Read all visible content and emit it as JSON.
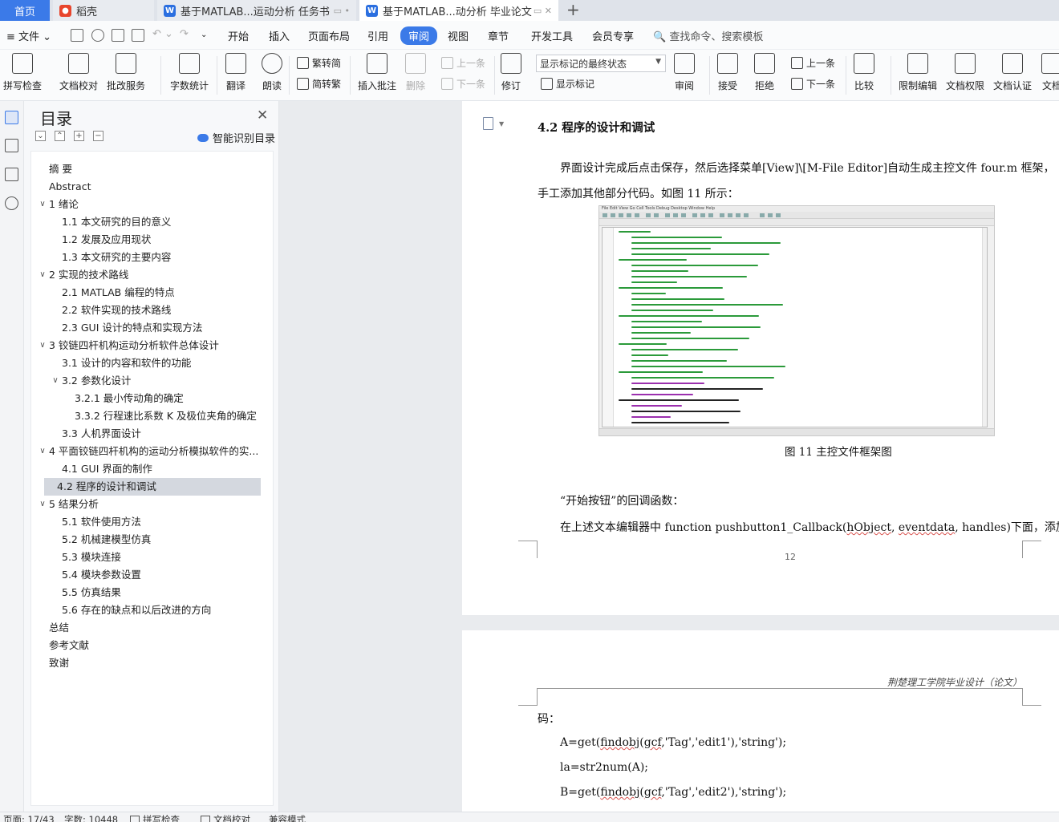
{
  "tabs": {
    "home": "首页",
    "daoke": "稻壳",
    "doc1": "基于MATLAB...运动分析 任务书",
    "doc2": "基于MATLAB...动分析 毕业论文",
    "add": "+"
  },
  "menu": {
    "file": "文件",
    "items": [
      "开始",
      "插入",
      "页面布局",
      "引用",
      "审阅",
      "视图",
      "章节",
      "开发工具",
      "会员专享"
    ],
    "active": "审阅",
    "search": "查找命令、搜索模板"
  },
  "ribbon": {
    "spellcheck": "拼写检查",
    "proofread": "文档校对",
    "annotate_service": "批改服务",
    "wordcount": "字数统计",
    "translate": "翻译",
    "read_aloud": "朗读",
    "trad": "繁转简",
    "simp": "简转繁",
    "insert_comment": "插入批注",
    "delete": "删除",
    "prev_comment": "上一条",
    "next_comment": "下一条",
    "revise": "修订",
    "markup_select": "显示标记的最终状态",
    "show_markup": "显示标记",
    "review": "审阅",
    "accept": "接受",
    "reject": "拒绝",
    "prev_change": "上一条",
    "next_change": "下一条",
    "compare": "比较",
    "restrict_edit": "限制编辑",
    "doc_rights": "文档权限",
    "doc_auth": "文档认证",
    "doc_more": "文档"
  },
  "toc": {
    "title": "目录",
    "smart": "智能识别目录",
    "items": [
      {
        "label": "摘  要",
        "level": 0,
        "arrow": ""
      },
      {
        "label": "Abstract",
        "level": 0,
        "arrow": ""
      },
      {
        "label": "1  绪论",
        "level": 0,
        "arrow": "∨"
      },
      {
        "label": "1.1  本文研究的目的意义",
        "level": 1,
        "arrow": ""
      },
      {
        "label": "1.2  发展及应用现状",
        "level": 1,
        "arrow": ""
      },
      {
        "label": "1.3  本文研究的主要内容",
        "level": 1,
        "arrow": ""
      },
      {
        "label": "2  实现的技术路线",
        "level": 0,
        "arrow": "∨"
      },
      {
        "label": "2.1 MATLAB 编程的特点",
        "level": 1,
        "arrow": ""
      },
      {
        "label": "2.2  软件实现的技术路线",
        "level": 1,
        "arrow": ""
      },
      {
        "label": "2.3 GUI 设计的特点和实现方法",
        "level": 1,
        "arrow": ""
      },
      {
        "label": "3  铰链四杆机构运动分析软件总体设计",
        "level": 0,
        "arrow": "∨"
      },
      {
        "label": "3.1  设计的内容和软件的功能",
        "level": 1,
        "arrow": ""
      },
      {
        "label": "3.2  参数化设计",
        "level": 1,
        "arrow": "∨"
      },
      {
        "label": "3.2.1  最小传动角的确定",
        "level": 2,
        "arrow": ""
      },
      {
        "label": "3.3.2  行程速比系数 K 及极位夹角的确定",
        "level": 2,
        "arrow": ""
      },
      {
        "label": "3.3  人机界面设计",
        "level": 1,
        "arrow": ""
      },
      {
        "label": "4  平面铰链四杆机构的运动分析模拟软件的实...",
        "level": 0,
        "arrow": "∨"
      },
      {
        "label": "4.1 GUI 界面的制作",
        "level": 1,
        "arrow": ""
      },
      {
        "label": "4.2  程序的设计和调试",
        "level": 1,
        "arrow": "",
        "selected": true
      },
      {
        "label": "5  结果分析",
        "level": 0,
        "arrow": "∨"
      },
      {
        "label": "5.1 软件使用方法",
        "level": 1,
        "arrow": ""
      },
      {
        "label": "5.2  机械建模型仿真",
        "level": 1,
        "arrow": ""
      },
      {
        "label": "5.3  模块连接",
        "level": 1,
        "arrow": ""
      },
      {
        "label": "5.4  模块参数设置",
        "level": 1,
        "arrow": ""
      },
      {
        "label": "5.5  仿真结果",
        "level": 1,
        "arrow": ""
      },
      {
        "label": "5.6  存在的缺点和以后改进的方向",
        "level": 1,
        "arrow": ""
      },
      {
        "label": "总结",
        "level": 0,
        "arrow": ""
      },
      {
        "label": "参考文献",
        "level": 0,
        "arrow": ""
      },
      {
        "label": "致谢",
        "level": 0,
        "arrow": ""
      }
    ]
  },
  "doc": {
    "heading": "4.2  程序的设计和调试",
    "para1_line1": "界面设计完成后点击保存，然后选择菜单[View]\\[M-File Editor]自动生成主控文件 four.m 框架，",
    "para1_line2": "手工添加其他部分代码。如图 11 所示：",
    "fig_menu": "File  Edit  View  Go  Cell  Tools  Debug  Desktop  Window  Help",
    "fig_caption": "图 11 主控文件框架图",
    "para2": "“开始按钮”的回调函数：",
    "para3_a": "在上述文本编辑器中 function pushbutton1_Callback(",
    "para3_w1": "hObject",
    "para3_b": ", ",
    "para3_w2": "eventdata",
    "para3_c": ", handles)下面，添加如下代",
    "page_num": "12",
    "header": "荆楚理工学院毕业设计（论文）",
    "p2_line1": "码：",
    "p2_line2_a": "A=get(",
    "p2_line2_w1": "findobj",
    "p2_line2_b": "(",
    "p2_line2_w2": "gcf",
    "p2_line2_c": ",'Tag','edit1'),'string');",
    "p2_line3": "la=str2num(A);",
    "p2_line4_a": "B=get(",
    "p2_line4_w1": "findobj",
    "p2_line4_b": "(",
    "p2_line4_w2": "gcf",
    "p2_line4_c": ",'Tag','edit2'),'string');"
  },
  "status": {
    "page": "页面: 17/43",
    "words": "字数: 10448",
    "spell": "拼写检查",
    "proof": "文档校对",
    "compat": "兼容模式"
  }
}
